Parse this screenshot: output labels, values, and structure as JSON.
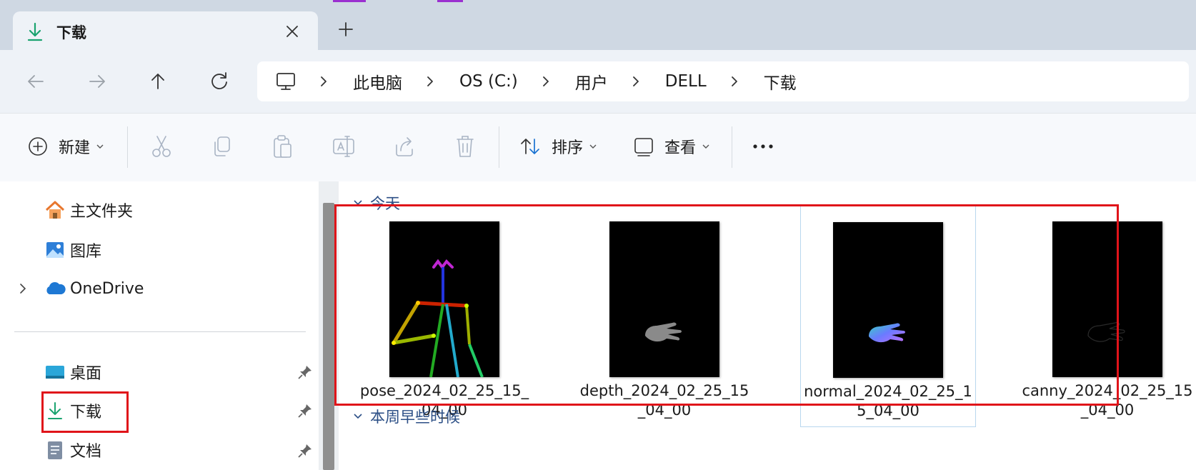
{
  "window": {
    "tab": {
      "title": "下载",
      "icon": "download-icon"
    },
    "new_tab_icon": "plus-icon"
  },
  "navigation": {
    "back_icon": "arrow-left-icon",
    "forward_icon": "arrow-right-icon",
    "up_icon": "arrow-up-icon",
    "refresh_icon": "refresh-icon",
    "breadcrumbs": [
      "此电脑",
      "OS (C:)",
      "用户",
      "DELL",
      "下载"
    ]
  },
  "toolbar": {
    "new_label": "新建",
    "sort_label": "排序",
    "view_label": "查看",
    "disabled_actions": [
      "cut-icon",
      "copy-icon",
      "paste-icon",
      "rename-icon",
      "share-icon",
      "delete-icon"
    ],
    "more_icon": "more-icon"
  },
  "sidebar": {
    "items": [
      {
        "label": "主文件夹",
        "icon": "home-icon"
      },
      {
        "label": "图库",
        "icon": "gallery-icon"
      },
      {
        "label": "OneDrive",
        "icon": "onedrive-cloud-icon"
      },
      {
        "label": "桌面",
        "icon": "desktop-icon",
        "pinned": true
      },
      {
        "label": "下载",
        "icon": "download-icon",
        "pinned": true,
        "highlighted": true
      },
      {
        "label": "文档",
        "icon": "document-icon",
        "pinned": true
      }
    ]
  },
  "content": {
    "groups": [
      {
        "label": "今天"
      },
      {
        "label": "本周早些时候"
      }
    ],
    "files": [
      {
        "name": "pose_2024_02_25_15_04_00",
        "thumbnail": "pose-skeleton"
      },
      {
        "name": "depth_2024_02_25_15_04_00",
        "thumbnail": "depth-hand"
      },
      {
        "name": "normal_2024_02_25_15_04_00",
        "thumbnail": "normal-hand",
        "selected": true
      },
      {
        "name": "canny_2024_02_25_15_04_00",
        "thumbnail": "canny-hand"
      }
    ]
  },
  "colors": {
    "accent": "#1a73d1",
    "highlight_box": "#e0141a",
    "group_header": "#2c4f86",
    "download_icon": "#1aa36f"
  }
}
